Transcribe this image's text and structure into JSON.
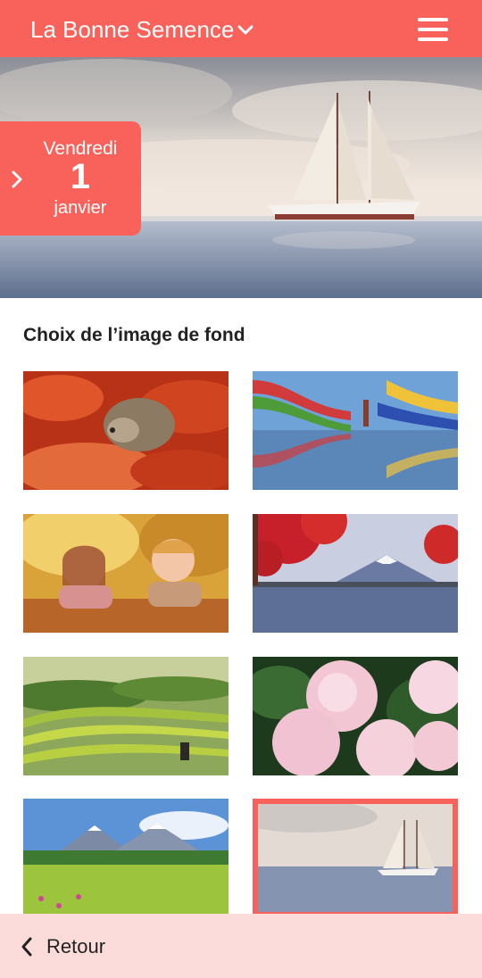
{
  "header": {
    "title": "La Bonne Semence"
  },
  "hero": {
    "date": {
      "weekday": "Vendredi",
      "day": "1",
      "month": "janvier"
    }
  },
  "section": {
    "title": "Choix de l’image de fond"
  },
  "gallery": {
    "selected_index": 7,
    "items": [
      {
        "name": "hedgehog-leaves"
      },
      {
        "name": "dyed-fabric-lake"
      },
      {
        "name": "children-autumn"
      },
      {
        "name": "mount-fuji-lake"
      },
      {
        "name": "rice-terraces"
      },
      {
        "name": "pink-peonies"
      },
      {
        "name": "alpine-meadow"
      },
      {
        "name": "sailboat-sea"
      }
    ]
  },
  "footer": {
    "back_label": "Retour"
  },
  "colors": {
    "accent": "#f9625a",
    "footer_bg": "#fcdcda"
  }
}
